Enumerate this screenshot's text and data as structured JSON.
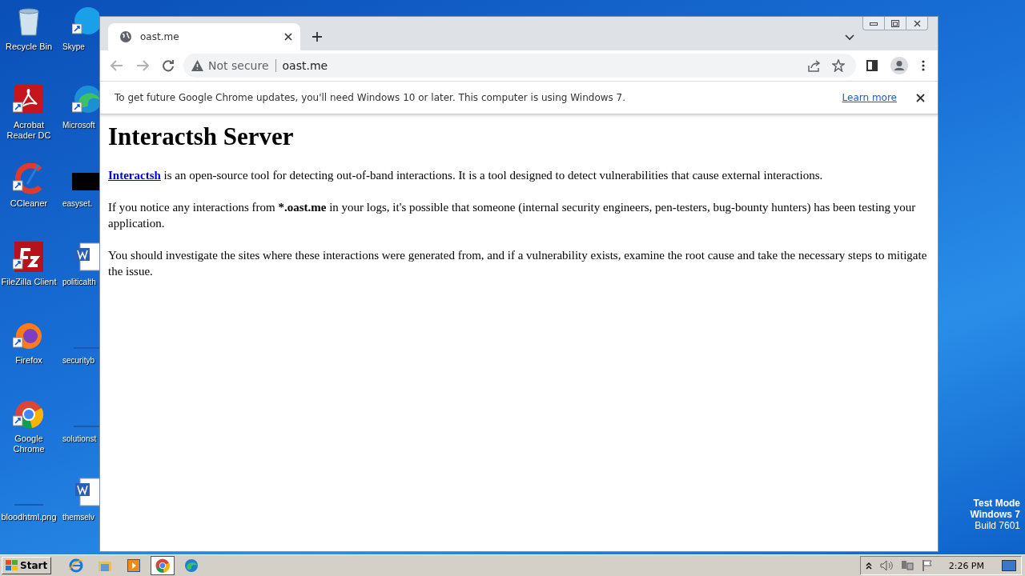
{
  "desktop": {
    "icon_columns": [
      [
        {
          "label": "Recycle Bin",
          "kind": "bin",
          "shortcut": false
        },
        {
          "label": "Acrobat Reader DC",
          "kind": "acrobat",
          "shortcut": true
        },
        {
          "label": "CCleaner",
          "kind": "ccleaner",
          "shortcut": true
        },
        {
          "label": "FileZilla Client",
          "kind": "filezilla",
          "shortcut": true
        },
        {
          "label": "Firefox",
          "kind": "firefox",
          "shortcut": true
        },
        {
          "label": "Google Chrome",
          "kind": "chrome",
          "shortcut": true
        },
        {
          "label": "bloodhtml.png",
          "kind": "blank",
          "shortcut": false
        }
      ],
      [
        {
          "label": "Skype",
          "kind": "skype",
          "shortcut": true
        },
        {
          "label": "Microsoft",
          "kind": "edge",
          "shortcut": true
        },
        {
          "label": "easyset.",
          "kind": "black",
          "shortcut": false
        },
        {
          "label": "politicalth",
          "kind": "word",
          "shortcut": false
        },
        {
          "label": "securityb",
          "kind": "blank",
          "shortcut": false
        },
        {
          "label": "solutionst",
          "kind": "blank",
          "shortcut": false
        },
        {
          "label": "themselv",
          "kind": "word",
          "shortcut": false
        }
      ]
    ],
    "watermark": [
      "Test Mode",
      "Windows 7",
      "Build 7601"
    ]
  },
  "browser": {
    "tabs": [
      {
        "title": "oast.me",
        "selected": true
      }
    ],
    "security": "Not secure",
    "url": "oast.me",
    "infobar": {
      "text": "To get future Google Chrome updates, you'll need Windows 10 or later. This computer is using Windows 7.",
      "link": "Learn more"
    },
    "page": {
      "heading": "Interactsh Server",
      "paragraphs": [
        [
          {
            "kind": "link",
            "text": "Interactsh"
          },
          {
            "kind": "text",
            "text": " is an open-source tool for detecting out-of-band interactions. It is a tool designed to detect vulnerabilities that cause external interactions."
          }
        ],
        [
          {
            "kind": "text",
            "text": "If you notice any interactions from "
          },
          {
            "kind": "bold",
            "text": "*.oast.me"
          },
          {
            "kind": "text",
            "text": " in your logs, it's possible that someone (internal security engineers, pen-testers, bug-bounty hunters) has been testing your application."
          }
        ],
        [
          {
            "kind": "text",
            "text": "You should investigate the sites where these interactions were generated from, and if a vulnerability exists, examine the root cause and take the necessary steps to mitigate the issue."
          }
        ]
      ]
    }
  },
  "taskbar": {
    "start": "Start",
    "apps": [
      {
        "kind": "ie",
        "selected": false
      },
      {
        "kind": "explorer",
        "selected": false
      },
      {
        "kind": "media",
        "selected": false
      },
      {
        "kind": "chrome",
        "selected": true
      },
      {
        "kind": "edge",
        "selected": false
      }
    ],
    "time": "2:26 PM"
  }
}
